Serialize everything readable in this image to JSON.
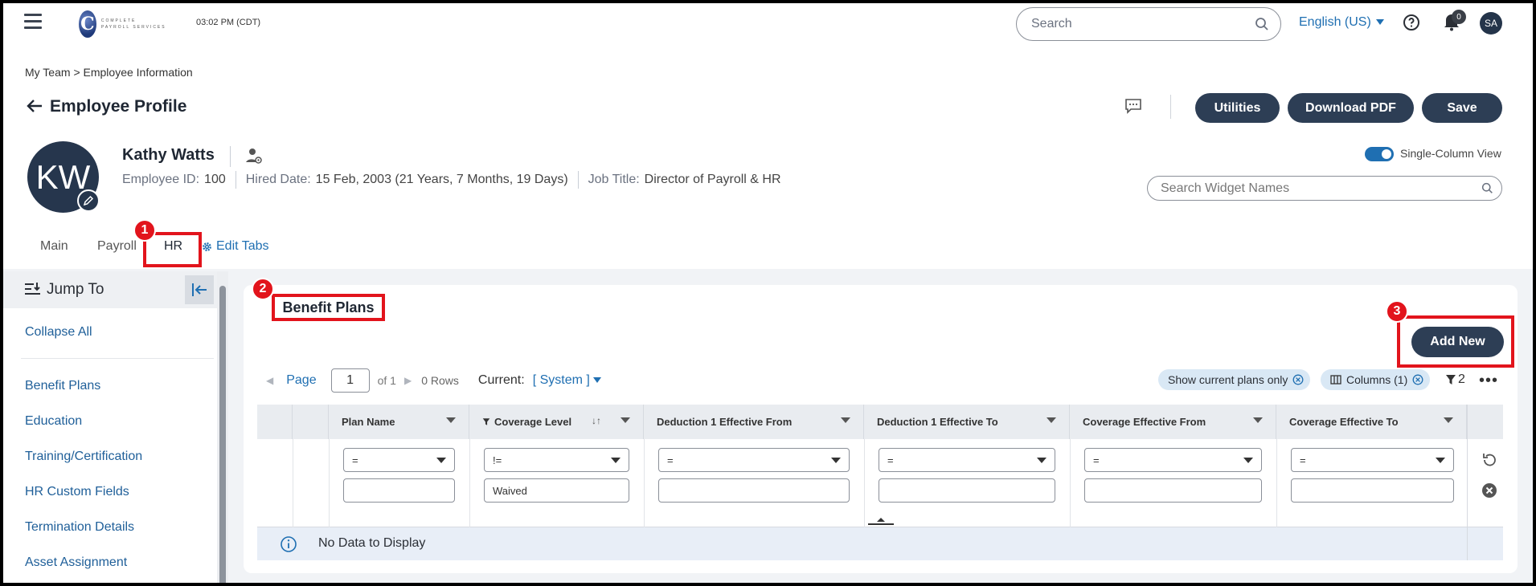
{
  "topbar": {
    "clock": "03:02 PM (CDT)",
    "logo_letter": "C",
    "logo_text": "COMPLETE PAYROLL SERVICES",
    "search_placeholder": "Search",
    "language": "English (US)",
    "notifications": "0",
    "user_initials": "SA"
  },
  "breadcrumb": {
    "parent": "My Team",
    "separator": ">",
    "current": "Employee Information"
  },
  "page": {
    "title": "Employee Profile",
    "buttons": {
      "utilities": "Utilities",
      "download_pdf": "Download PDF",
      "save": "Save"
    }
  },
  "employee": {
    "initials": "KW",
    "name": "Kathy Watts",
    "id_label": "Employee ID:",
    "id": "100",
    "hired_label": "Hired Date:",
    "hired": "15 Feb, 2003 (21 Years, 7 Months, 19 Days)",
    "job_label": "Job Title:",
    "job": "Director of Payroll & HR"
  },
  "view": {
    "single_column_label": "Single-Column View",
    "single_column_on": true,
    "widget_search_placeholder": "Search Widget Names"
  },
  "tabs": {
    "main": "Main",
    "payroll": "Payroll",
    "hr": "HR",
    "edit": "Edit Tabs"
  },
  "steps": [
    "1",
    "2",
    "3"
  ],
  "sidebar": {
    "jump_to": "Jump To",
    "collapse_all": "Collapse All",
    "items": [
      "Benefit Plans",
      "Education",
      "Training/Certification",
      "HR Custom Fields",
      "Termination Details",
      "Asset Assignment"
    ]
  },
  "benefit_plans": {
    "title": "Benefit Plans",
    "add_new": "Add New",
    "pager": {
      "page_label": "Page",
      "page": "1",
      "of": "of 1",
      "rows": "0 Rows",
      "current_label": "Current:",
      "current_view": "[ System ]"
    },
    "chips": [
      "Show current plans only",
      "Columns (1)"
    ],
    "filter_count": "2",
    "more": "•••",
    "columns": [
      "Plan Name",
      "Coverage Level",
      "Deduction 1 Effective From",
      "Deduction 1 Effective To",
      "Coverage Effective From",
      "Coverage Effective To"
    ],
    "operators": [
      "=",
      "!=",
      "=",
      "=",
      "=",
      "="
    ],
    "values": [
      "",
      "Waived",
      "",
      "",
      "",
      ""
    ],
    "empty_message": "No Data to Display"
  },
  "colors": {
    "accent": "#1f6fb2",
    "dark_button": "#2d3e55",
    "highlight": "#e2141c"
  }
}
